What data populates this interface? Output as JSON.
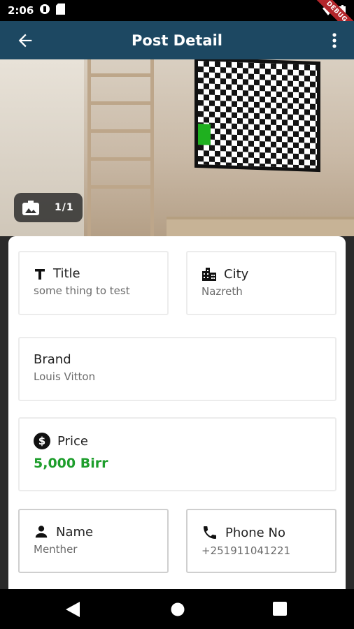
{
  "status_bar": {
    "time": "2:06",
    "debug_label": "DEBUG"
  },
  "app_bar": {
    "title": "Post Detail"
  },
  "photo": {
    "counter": "1/1"
  },
  "details": {
    "title": {
      "label": "Title",
      "value": "some thing to test"
    },
    "city": {
      "label": "City",
      "value": "Nazreth"
    },
    "brand": {
      "label": "Brand",
      "value": "Louis Vitton"
    },
    "price": {
      "label": "Price",
      "value": "5,000 Birr"
    },
    "name": {
      "label": "Name",
      "value": "Menther"
    },
    "phone": {
      "label": "Phone No",
      "value": "+251911041221"
    }
  },
  "colors": {
    "app_bar": "#1d4862",
    "price": "#1e9e2c",
    "debug": "#b3262b"
  },
  "icons": [
    "back-arrow-icon",
    "more-vert-icon",
    "photo-icon",
    "title-icon",
    "city-icon",
    "price-icon",
    "person-icon",
    "phone-icon"
  ]
}
